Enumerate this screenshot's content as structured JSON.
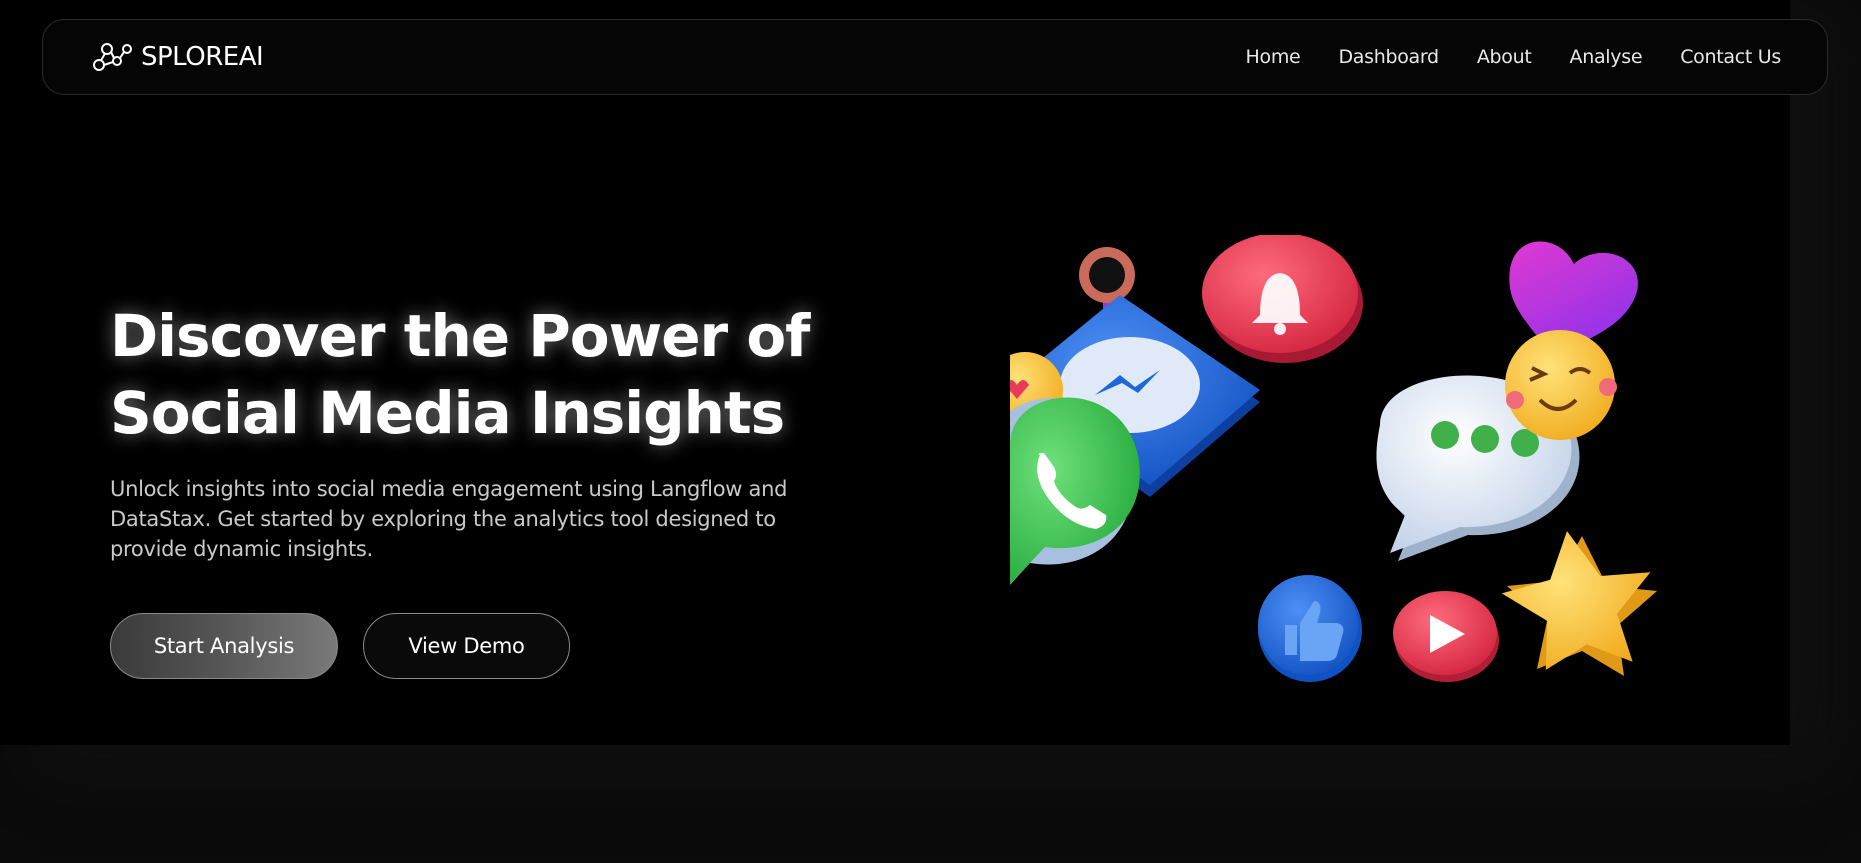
{
  "navbar": {
    "brand": "SPLOREAI",
    "links": [
      "Home",
      "Dashboard",
      "About",
      "Analyse",
      "Contact Us"
    ]
  },
  "hero": {
    "title_line1": "Discover the Power of",
    "title_line2": "Social Media Insights",
    "description": "Unlock insights into social media engagement using Langflow and DataStax. Get started by exploring the analytics tool designed to provide dynamic insights.",
    "primary_button": "Start Analysis",
    "secondary_button": "View Demo"
  },
  "colors": {
    "background": "#000000",
    "whatsapp_green": "#3dbf4a",
    "messenger_blue": "#1f66d9",
    "notification_red": "#e8384f",
    "heart_purple": "#b63ae0",
    "emoji_yellow": "#f7c52b"
  },
  "icons": [
    "network-logo-icon",
    "whatsapp-icon",
    "messenger-icon",
    "bell-icon",
    "heart-icon",
    "emoji-love-icon",
    "emoji-wink-icon",
    "chat-bubble-icon",
    "like-icon",
    "play-icon",
    "star-icon",
    "location-pin-icon"
  ]
}
